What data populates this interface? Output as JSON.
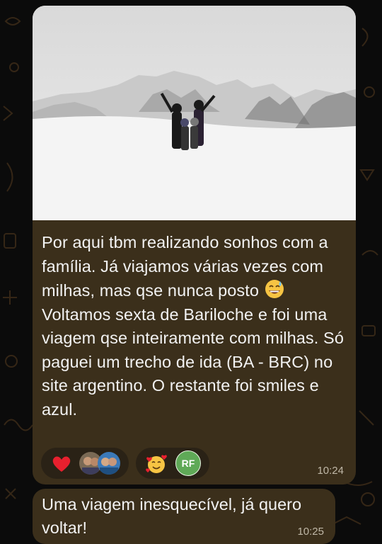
{
  "message1": {
    "paragraph1": "Por aqui tbm realizando sonhos com a família. Já viajamos várias vezes com milhas, mas qse nunca posto",
    "emoji": "sweat-smile-emoji",
    "paragraph2": "Voltamos sexta de Bariloche e foi uma viagem qse inteiramente com milhas. Só paguei um trecho de ida (BA - BRC) no site argentino. O restante foi smiles e azul.",
    "time": "10:24",
    "photo": "snowy-mountain-family-photo",
    "reactions": [
      {
        "emoji": "heart-emoji",
        "avatars": [
          "user-avatar-1",
          "user-avatar-2"
        ]
      },
      {
        "emoji": "smiling-face-with-hearts-emoji",
        "avatar_initials": "RF"
      }
    ]
  },
  "message2": {
    "text": "Uma viagem inesquecível, já quero voltar!",
    "time": "10:25"
  },
  "colors": {
    "bubble": "#3b2f1b",
    "background": "#0b0b0b",
    "text": "#f2f2f2",
    "time": "#bfb7a7",
    "rf_badge": "#5fa957"
  }
}
